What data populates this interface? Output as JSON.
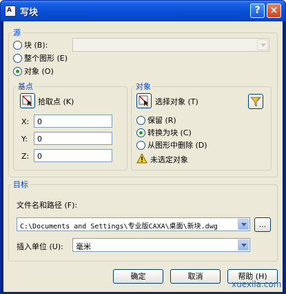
{
  "window": {
    "title": "写块",
    "icon_glyph": "A",
    "help_symbol": "?",
    "close_symbol": "×"
  },
  "source": {
    "legend": "源",
    "options": [
      "块 (B):",
      "整个图形 (E)",
      "对象 (O)"
    ],
    "selected_index": 2,
    "block_combo_value": ""
  },
  "base_point": {
    "legend": "基点",
    "pick_label": "拾取点 (K)",
    "x_label": "X:",
    "x_value": "0",
    "y_label": "Y:",
    "y_value": "0",
    "z_label": "Z:",
    "z_value": "0"
  },
  "objects": {
    "legend": "对象",
    "select_label": "选择对象 (T)",
    "options": [
      "保留 (R)",
      "转换为块 (C)",
      "从图形中删除 (D)"
    ],
    "selected_index": 1,
    "status_text": "未选定对象"
  },
  "destination": {
    "legend": "目标",
    "path_label": "文件名和路径 (F):",
    "path_value": "C:\\Documents and Settings\\专业版CAXA\\桌面\\新块.dwg",
    "browse_label": "...",
    "units_label": "插入单位 (U):",
    "units_value": "毫米"
  },
  "buttons": {
    "ok": "确定",
    "cancel": "取消",
    "help": "帮助 (H)"
  },
  "watermark": "xuexila.com"
}
